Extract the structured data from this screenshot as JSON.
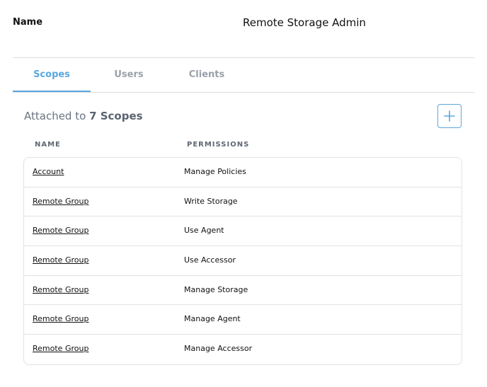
{
  "header": {
    "name_label": "Name",
    "name_value": "Remote Storage Admin"
  },
  "tabs": [
    {
      "label": "Scopes",
      "active": true
    },
    {
      "label": "Users",
      "active": false
    },
    {
      "label": "Clients",
      "active": false
    }
  ],
  "section": {
    "title_prefix": "Attached to",
    "title_count": "7 Scopes",
    "add_icon": "plus-icon"
  },
  "table": {
    "columns": [
      "NAME",
      "PERMISSIONS"
    ],
    "rows": [
      {
        "name": "Account",
        "permission": "Manage Policies"
      },
      {
        "name": "Remote Group",
        "permission": "Write Storage"
      },
      {
        "name": "Remote Group",
        "permission": "Use Agent"
      },
      {
        "name": "Remote Group",
        "permission": "Use Accessor"
      },
      {
        "name": "Remote Group",
        "permission": "Manage Storage"
      },
      {
        "name": "Remote Group",
        "permission": "Manage Agent"
      },
      {
        "name": "Remote Group",
        "permission": "Manage Accessor"
      }
    ]
  },
  "colors": {
    "accent": "#5aa7e0",
    "muted_text": "#9aa1a9",
    "border": "#dfe2e6"
  }
}
